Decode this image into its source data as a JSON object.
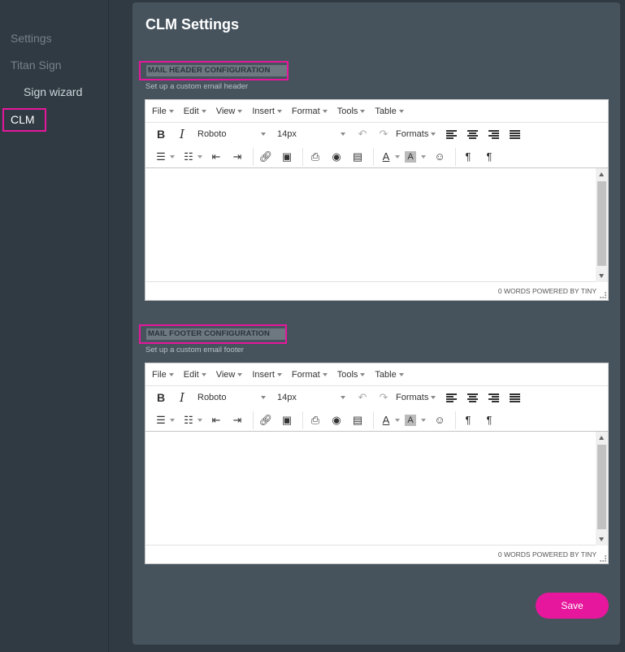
{
  "sidebar": {
    "items": [
      {
        "label": "Settings"
      },
      {
        "label": "Titan Sign"
      },
      {
        "label": "Sign wizard"
      },
      {
        "label": "CLM"
      }
    ]
  },
  "page": {
    "title": "CLM Settings"
  },
  "header_section": {
    "label": "MAIL HEADER CONFIGURATION",
    "description": "Set up a custom email header"
  },
  "footer_section": {
    "label": "MAIL FOOTER CONFIGURATION",
    "description": "Set up a custom email footer"
  },
  "editor": {
    "menu": [
      "File",
      "Edit",
      "View",
      "Insert",
      "Format",
      "Tools",
      "Table"
    ],
    "font": "Roboto",
    "size": "14px",
    "formats": "Formats",
    "status": "0 WORDS POWERED BY TINY"
  },
  "save_label": "Save",
  "colors": {
    "accent": "#e6179c",
    "panel": "#46535d",
    "sidebar": "#2f3a42"
  }
}
